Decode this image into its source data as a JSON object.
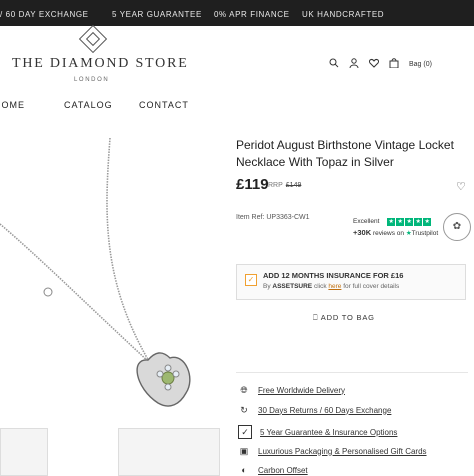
{
  "topbar": {
    "items": [
      "/ 60 DAY EXCHANGE",
      "5 YEAR GUARANTEE",
      "0% APR FINANCE",
      "UK HANDCRAFTED"
    ]
  },
  "header": {
    "brand": "THE DIAMOND STORE",
    "brand_sub": "LONDON",
    "bag_label": "Bag (0)"
  },
  "nav": {
    "items": [
      "HOME",
      "CATALOG",
      "CONTACT"
    ]
  },
  "product": {
    "title": "Peridot August Birthstone Vintage Locket Necklace With Topaz in Silver",
    "price": "£119",
    "rrp_label": "RRP",
    "rrp_value": "£149",
    "item_ref": "Item Ref: UP3363-CW1",
    "trustpilot": {
      "rating_label": "Excellent",
      "reviews_count": "+30K",
      "reviews_text": "reviews on",
      "brand": "Trustpilot"
    },
    "insurance": {
      "line1": "ADD 12 MONTHS INSURANCE FOR £16",
      "by": "By",
      "asset": "ASSETSURE",
      "click": "click",
      "here": "here",
      "rest": "for full cover details"
    },
    "add_to_bag": "ADD TO BAG",
    "features": [
      {
        "icon": "globe-icon",
        "text": "Free Worldwide Delivery"
      },
      {
        "icon": "return-icon",
        "text": "30 Days Returns / 60 Days Exchange"
      },
      {
        "icon": "shield-check-icon",
        "text": "5 Year Guarantee & Insurance Options"
      },
      {
        "icon": "gift-icon",
        "text": "Luxurious Packaging & Personalised Gift Cards"
      },
      {
        "icon": "offset-icon",
        "text": "Carbon Offset"
      }
    ]
  },
  "colors": {
    "topbar_bg": "#1f1f1f",
    "trustpilot_green": "#00b67a",
    "insurance_accent": "#f0a030"
  }
}
